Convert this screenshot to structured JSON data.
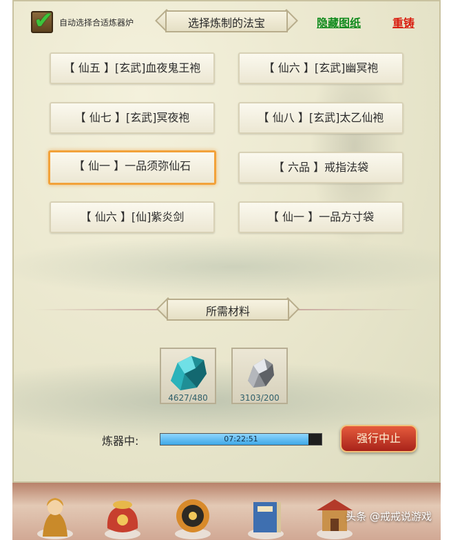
{
  "header": {
    "auto_select_label": "自动选择合适炼器炉",
    "auto_select_checked": true,
    "title": "选择炼制的法宝",
    "hide_blueprint": "隐藏图纸",
    "recast": "重铸"
  },
  "items": [
    {
      "label": "【 仙五 】[玄武]血夜鬼王袍"
    },
    {
      "label": "【 仙六 】[玄武]幽冥袍"
    },
    {
      "label": "【 仙七 】[玄武]冥夜袍"
    },
    {
      "label": "【 仙八 】[玄武]太乙仙袍"
    },
    {
      "label": "【 仙一 】一品须弥仙石",
      "selected": true
    },
    {
      "label": "【 六品 】戒指法袋"
    },
    {
      "label": "【 仙六 】[仙]紫炎剑"
    },
    {
      "label": "【 仙一 】一品方寸袋"
    }
  ],
  "materials": {
    "title": "所需材料",
    "list": [
      {
        "icon": "teal-ore-icon",
        "count": "4627/480"
      },
      {
        "icon": "silver-ore-icon",
        "count": "3103/200"
      }
    ]
  },
  "status": {
    "label": "炼器中:",
    "timer": "07:22:51",
    "progress": 0.92,
    "abort": "强行中止"
  },
  "bottom_nav": [
    "monk-icon",
    "treasure-bag-icon",
    "taiji-shield-icon",
    "scroll-book-icon",
    "pavilion-icon"
  ],
  "watermark": "头条 @戒戒说游戏",
  "colors": {
    "accent_green": "#0f8a1c",
    "accent_red": "#d91e10",
    "selected_border": "#f2a23a",
    "progress_fill": "#3da7e6"
  }
}
